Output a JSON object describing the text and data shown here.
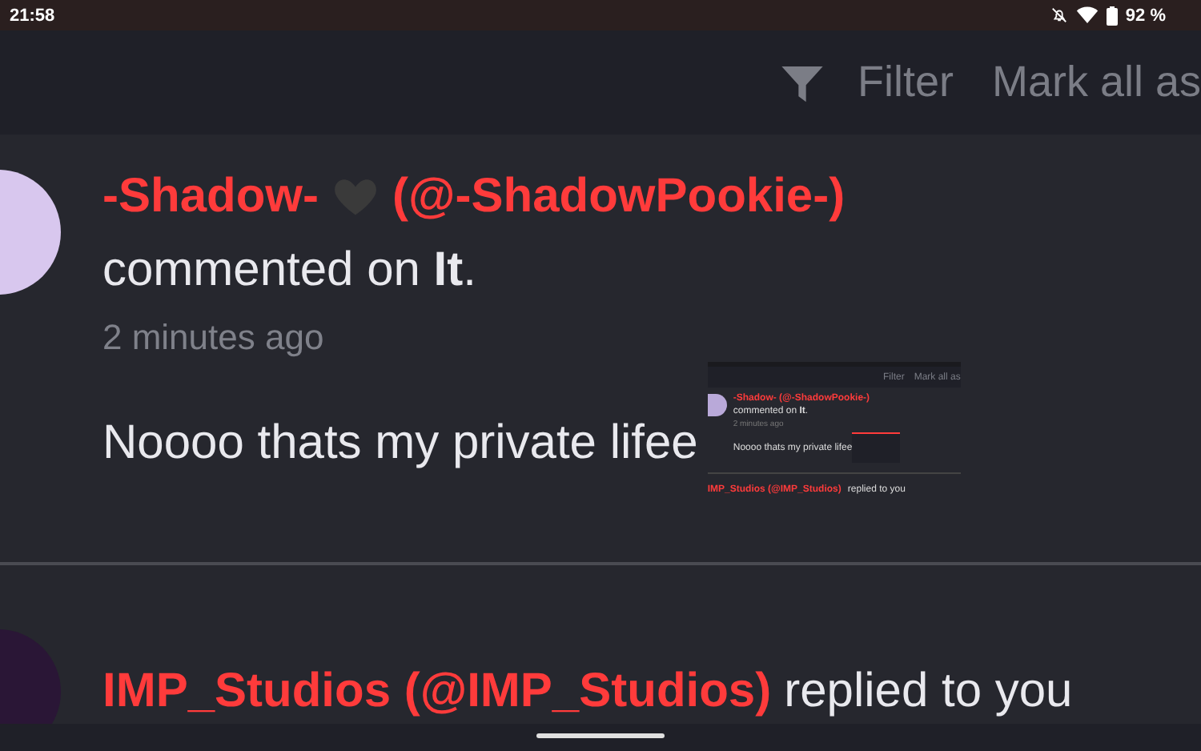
{
  "status_bar": {
    "time": "21:58",
    "battery": "92 %"
  },
  "header": {
    "actions": [
      {
        "kind": "filter",
        "label": "Filter"
      },
      {
        "kind": "text",
        "label": "Mark all as"
      }
    ]
  },
  "notifications": [
    {
      "author": "-Shadow-",
      "handle": "(@-ShadowPookie-)",
      "action": "commented on **It**.",
      "time": "2 minutes ago",
      "body": "Noooo thats my private lifee",
      "attachment": {
        "filter": "Filter",
        "mark": "Mark all as",
        "author": "-Shadow-",
        "handle": "(@-ShadowPookie-)",
        "action": "commented on **It**.",
        "time": "2 minutes ago",
        "body": "Noooo thats my private lifee",
        "next_author": "IMP_Studios (@IMP_Studios)",
        "next_action": "replied to you"
      }
    },
    {
      "author": "IMP_Studios (@IMP_Studios)",
      "action": "replied to you"
    }
  ]
}
